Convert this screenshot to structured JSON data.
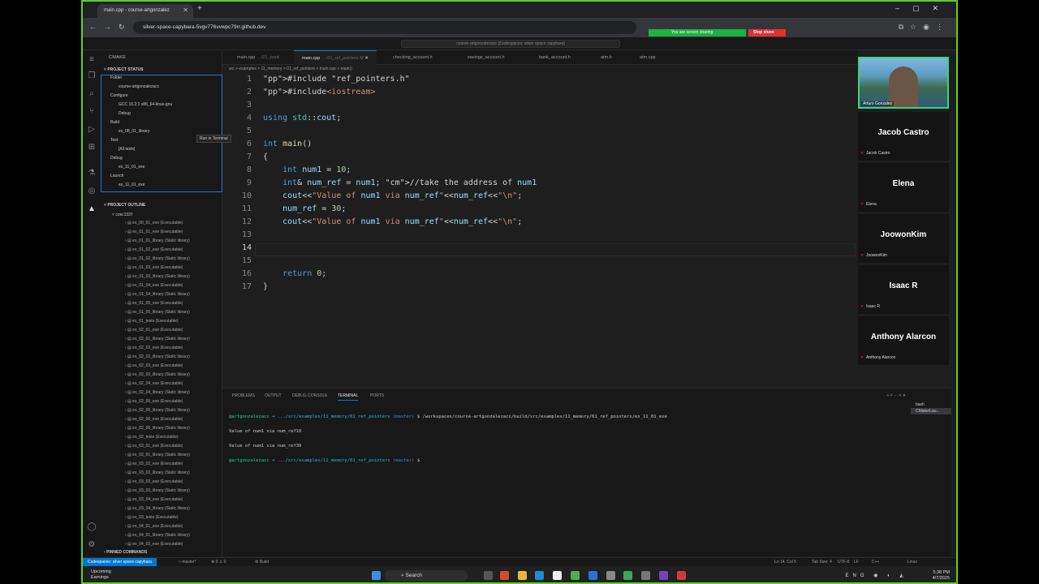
{
  "browser": {
    "tab_title": "main.cpp - course-artgonzalez",
    "url": "silver-space-capybara-5vgv776vvwpc79rr.github.dev",
    "sharing_text": "You are screen sharing",
    "stop_share": "Stop share"
  },
  "vscode": {
    "search_text": "course-artgonzalezacc [Codespaces: silver space capybara]",
    "sidebar_title": "CMAKE",
    "project_status": "PROJECT STATUS",
    "tree": [
      {
        "label": "Folder",
        "indent": 0
      },
      {
        "label": "course-artgonzalezacc",
        "indent": 1
      },
      {
        "label": "Configure",
        "indent": 0
      },
      {
        "label": "GCC 10.2.1 x86_64-linux-gnu",
        "indent": 1
      },
      {
        "label": "Debug",
        "indent": 1
      },
      {
        "label": "Build",
        "indent": 0
      },
      {
        "label": "ex_08_01_library",
        "indent": 1
      },
      {
        "label": "Test",
        "indent": 0
      },
      {
        "label": "[All tests]",
        "indent": 1
      },
      {
        "label": "Debug",
        "indent": 0
      },
      {
        "label": "ex_11_01_exe",
        "indent": 1
      },
      {
        "label": "Launch",
        "indent": 0
      },
      {
        "label": "ex_11_01_exe",
        "indent": 1
      }
    ],
    "tooltip": "Run in Terminal",
    "project_outline": "PROJECT OUTLINE",
    "outline_root": "cosc1337",
    "outline_items": [
      "ex_00_01_exe (Executable)",
      "ex_01_01_exe (Executable)",
      "ex_01_01_library (Static library)",
      "ex_01_02_exe (Executable)",
      "ex_01_02_library (Static library)",
      "ex_01_03_exe (Executable)",
      "ex_01_03_library (Static library)",
      "ex_01_04_exe (Executable)",
      "ex_01_04_library (Static library)",
      "ex_01_05_exe (Executable)",
      "ex_01_05_library (Static library)",
      "ex_01_tests (Executable)",
      "ex_02_01_exe (Executable)",
      "ex_02_01_library (Static library)",
      "ex_02_02_exe (Executable)",
      "ex_02_02_library (Static library)",
      "ex_02_03_exe (Executable)",
      "ex_02_03_library (Static library)",
      "ex_02_04_exe (Executable)",
      "ex_02_04_library (Static library)",
      "ex_02_05_exe (Executable)",
      "ex_02_05_library (Static library)",
      "ex_02_06_exe (Executable)",
      "ex_02_06_library (Static library)",
      "ex_02_tests (Executable)",
      "ex_03_01_exe (Executable)",
      "ex_03_01_library (Static library)",
      "ex_03_02_exe (Executable)",
      "ex_03_02_library (Static library)",
      "ex_03_03_exe (Executable)",
      "ex_03_03_library (Static library)",
      "ex_03_04_exe (Executable)",
      "ex_03_04_library (Static library)",
      "ex_03_tests (Executable)",
      "ex_04_01_exe (Executable)",
      "ex_04_01_library (Static library)",
      "ex_04_02_exe (Executable)"
    ],
    "pinned_commands": "PINNED COMMANDS",
    "tabs": [
      {
        "name": "main.cpp",
        "sub": "...\\01_bank"
      },
      {
        "name": "main.cpp",
        "sub": "...\\01_ref_pointers M"
      },
      {
        "name": "checking_account.h",
        "sub": ""
      },
      {
        "name": "savings_account.h",
        "sub": ""
      },
      {
        "name": "bank_account.h",
        "sub": ""
      },
      {
        "name": "atm.h",
        "sub": ""
      },
      {
        "name": "atm.cpp",
        "sub": ""
      }
    ],
    "breadcrumb": "src > examples > 11_memory > 01_ref_pointers > main.cpp > main()",
    "code_lines": [
      "#include \"ref_pointers.h\"",
      "#include<iostream>",
      "",
      "using std::cout;",
      "",
      "int main()",
      "{",
      "    int num1 = 10;",
      "    int& num_ref = num1; //take the address of num1",
      "    cout<<\"Value of num1 via num_ref\"<<num_ref<<\"\\n\";",
      "    num_ref = 30;",
      "    cout<<\"Value of num1 via num_ref\"<<num_ref<<\"\\n\";",
      "",
      "",
      "",
      "    return 0;",
      "}"
    ],
    "current_line": 14,
    "panel_tabs": [
      "PROBLEMS",
      "OUTPUT",
      "DEBUG CONSOLE",
      "TERMINAL",
      "PORTS"
    ],
    "active_panel_tab": "TERMINAL",
    "terminal": {
      "user": "@artgonzalezacc",
      "path": "➜ .../src/examples/11_memory/01_ref_pointers",
      "branch": "(master)",
      "command": "$ /workspaces/course-artgonzalezacc/build/src/examples/11_memory/01_ref_pointers/ex_11_01_exe",
      "output1": "Value of num1 via num_ref10",
      "output2": "Value of num1 via num_ref30",
      "prompt_end": "$"
    },
    "terminal_list": [
      "bash",
      "CMake/Lau..."
    ],
    "status": {
      "remote": "Codespaces: silver space capybara",
      "branch": "master*",
      "errors": "0",
      "warnings": "0",
      "build": "Build",
      "position": "Ln 14, Col 5",
      "tabsize": "Tab Size: 4",
      "encoding": "UTF-8",
      "eol": "LF",
      "language": "C++",
      "locale": "Linux"
    }
  },
  "meeting": {
    "presenter": "Arturo Gonzalez",
    "participants": [
      {
        "big": "Jacob Castro",
        "small": "Jacob Castro"
      },
      {
        "big": "Elena",
        "small": "Elena"
      },
      {
        "big": "JoowonKim",
        "small": "JoowonKim"
      },
      {
        "big": "Isaac R",
        "small": "Isaac R"
      },
      {
        "big": "Anthony Alarcon",
        "small": "Anthony Alarcon"
      }
    ]
  },
  "taskbar": {
    "weather_title": "Upcoming",
    "weather_sub": "Earnings",
    "search": "Search",
    "lang": "ENG",
    "time": "5:38 PM",
    "date": "4/7/2025"
  }
}
